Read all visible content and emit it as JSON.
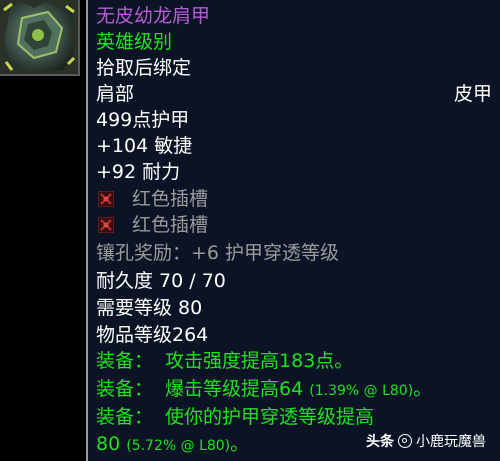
{
  "item": {
    "name": "无皮幼龙肩甲",
    "name_color": "#b75bd8",
    "difficulty": "英雄级别",
    "bind": "拾取后绑定",
    "slot": "肩部",
    "armor_type": "皮甲",
    "armor": "499点护甲",
    "stats": [
      "+104 敏捷",
      "+92 耐力"
    ],
    "sockets": [
      {
        "icon": "red-socket-icon",
        "label": "红色插槽"
      },
      {
        "icon": "red-socket-icon",
        "label": "红色插槽"
      }
    ],
    "socket_bonus": "镶孔奖励：+6 护甲穿透等级",
    "durability": "耐久度 70 / 70",
    "required_level": "需要等级 80",
    "item_level": "物品等级264",
    "equips": [
      {
        "prefix": "装备：",
        "text": "攻击强度提高183点。",
        "detail": ""
      },
      {
        "prefix": "装备：",
        "text": "爆击等级提高64",
        "detail": "(1.39% @ L80)",
        "suffix": "。"
      },
      {
        "prefix": "装备：",
        "text": "使你的护甲穿透等级提高",
        "text2": "80",
        "detail": "(5.72% @ L80)",
        "suffix": "。"
      }
    ]
  },
  "watermark": {
    "brand": "头条",
    "user": "小鹿玩魔兽"
  },
  "colors": {
    "background": "#0b1325",
    "epic": "#b75bd8",
    "green": "#1ee21e",
    "grey": "#9a9a9a"
  }
}
